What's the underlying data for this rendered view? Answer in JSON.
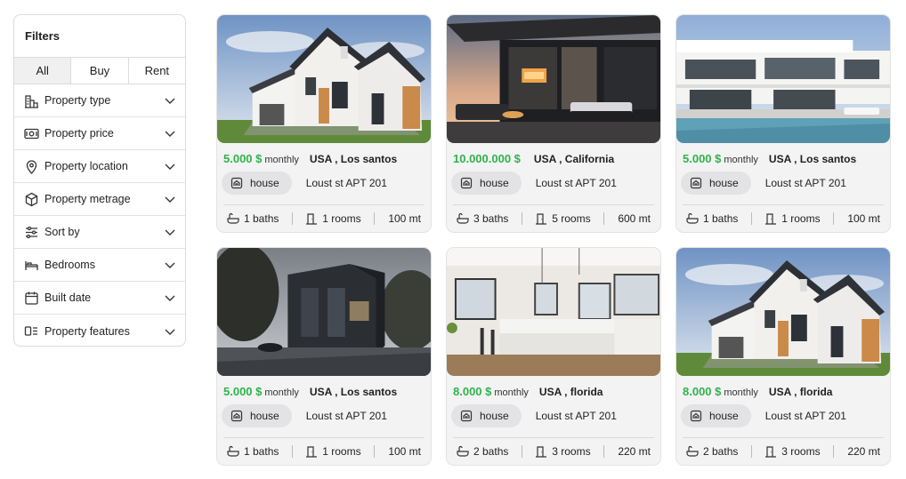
{
  "filters": {
    "title": "Filters",
    "segments": [
      "All",
      "Buy",
      "Rent"
    ],
    "rows": [
      {
        "label": "Property type",
        "icon": "building-chart-icon"
      },
      {
        "label": "Property price",
        "icon": "money-icon"
      },
      {
        "label": "Property location",
        "icon": "location-pin-icon"
      },
      {
        "label": "Property metrage",
        "icon": "cube-icon"
      },
      {
        "label": "Sort by",
        "icon": "sliders-icon"
      },
      {
        "label": "Bedrooms",
        "icon": "bed-icon"
      },
      {
        "label": "Built date",
        "icon": "calendar-icon"
      },
      {
        "label": "Property features",
        "icon": "features-icon"
      }
    ]
  },
  "cards": [
    {
      "price": "5.000 $",
      "period": "monthly",
      "location": "USA , Los santos",
      "type": "house",
      "address": "Loust st APT 201",
      "baths": "1 baths",
      "rooms": "1 rooms",
      "area": "100 mt",
      "photo": "white-house"
    },
    {
      "price": "10.000.000 $",
      "period": "",
      "location": "USA , California",
      "type": "house",
      "address": "Loust st APT 201",
      "baths": "3 baths",
      "rooms": "5 rooms",
      "area": "600 mt",
      "photo": "dusk-terrace"
    },
    {
      "price": "5.000 $",
      "period": "monthly",
      "location": "USA , Los santos",
      "type": "house",
      "address": "Loust st APT 201",
      "baths": "1 baths",
      "rooms": "1 rooms",
      "area": "100 mt",
      "photo": "pool-villa"
    },
    {
      "price": "5.000 $",
      "period": "monthly",
      "location": "USA , Los santos",
      "type": "house",
      "address": "Loust st APT 201",
      "baths": "1 baths",
      "rooms": "1 rooms",
      "area": "100 mt",
      "photo": "dark-modern"
    },
    {
      "price": "8.000 $",
      "period": "monthly",
      "location": "USA , florida",
      "type": "house",
      "address": "Loust st APT 201",
      "baths": "2 baths",
      "rooms": "3 rooms",
      "area": "220 mt",
      "photo": "kitchen"
    },
    {
      "price": "8.000 $",
      "period": "monthly",
      "location": "USA , florida",
      "type": "house",
      "address": "Loust st APT 201",
      "baths": "2 baths",
      "rooms": "3 rooms",
      "area": "220 mt",
      "photo": "white-house"
    }
  ],
  "colors": {
    "price": "#2fb34b",
    "card_bg": "#f3f3f4",
    "pill_bg": "#e3e3e5",
    "border": "#dcdcdc"
  }
}
